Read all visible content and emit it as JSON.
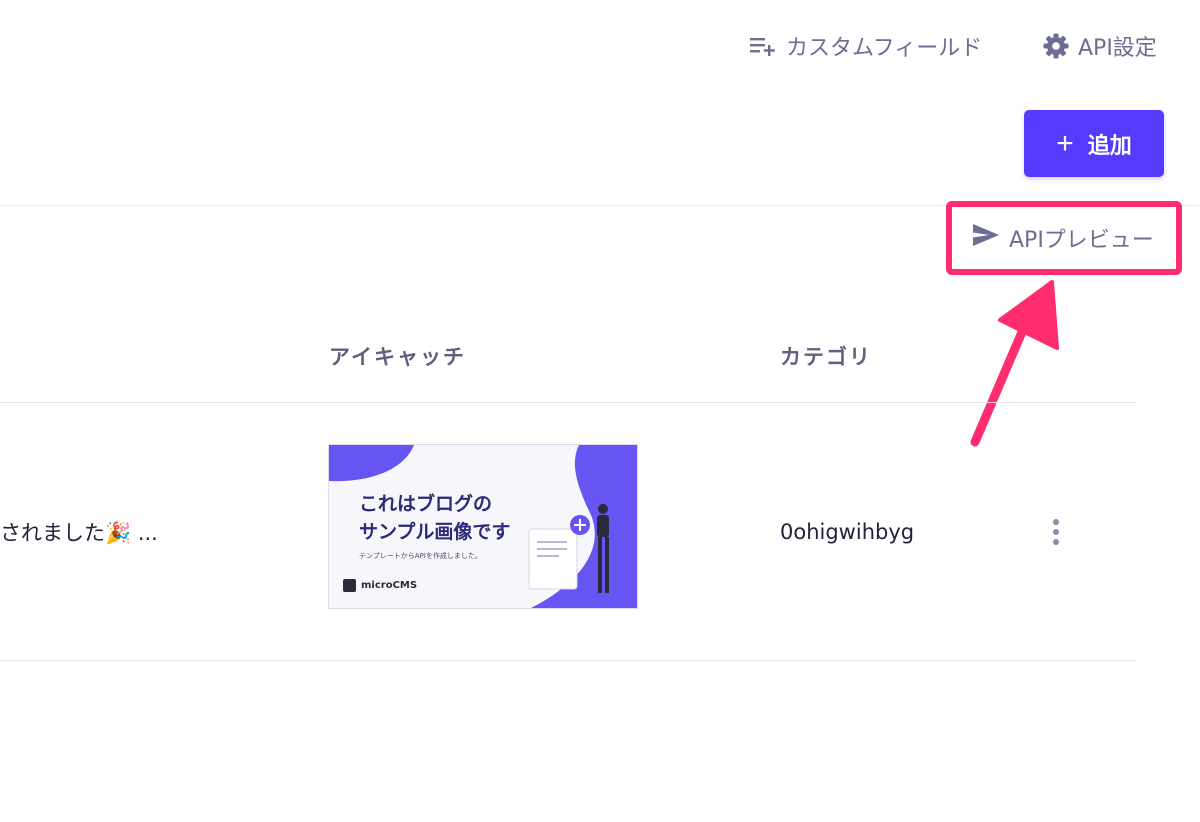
{
  "header": {
    "custom_field_label": "カスタムフィールド",
    "api_settings_label": "API設定"
  },
  "toolbar": {
    "add_label": "追加",
    "api_preview_label": "APIプレビュー"
  },
  "table": {
    "columns": [
      "アイキャッチ",
      "カテゴリ"
    ],
    "rows": [
      {
        "title": "されました🎉 ...",
        "category": "0ohigwihbyg"
      }
    ]
  },
  "thumbnail": {
    "title_line1": "これはブログの",
    "title_line2": "サンプル画像です",
    "subtitle": "テンプレートからAPIを作成しました。",
    "logo": "microCMS"
  },
  "colors": {
    "accent": "#563bff",
    "highlight": "#ff2d6e",
    "muted_text": "#6c6d93"
  },
  "icons": {
    "custom_field": "list-plus-icon",
    "settings": "gear-icon",
    "preview": "send-icon",
    "add": "plus-icon",
    "row_menu": "kebab-menu-icon"
  }
}
